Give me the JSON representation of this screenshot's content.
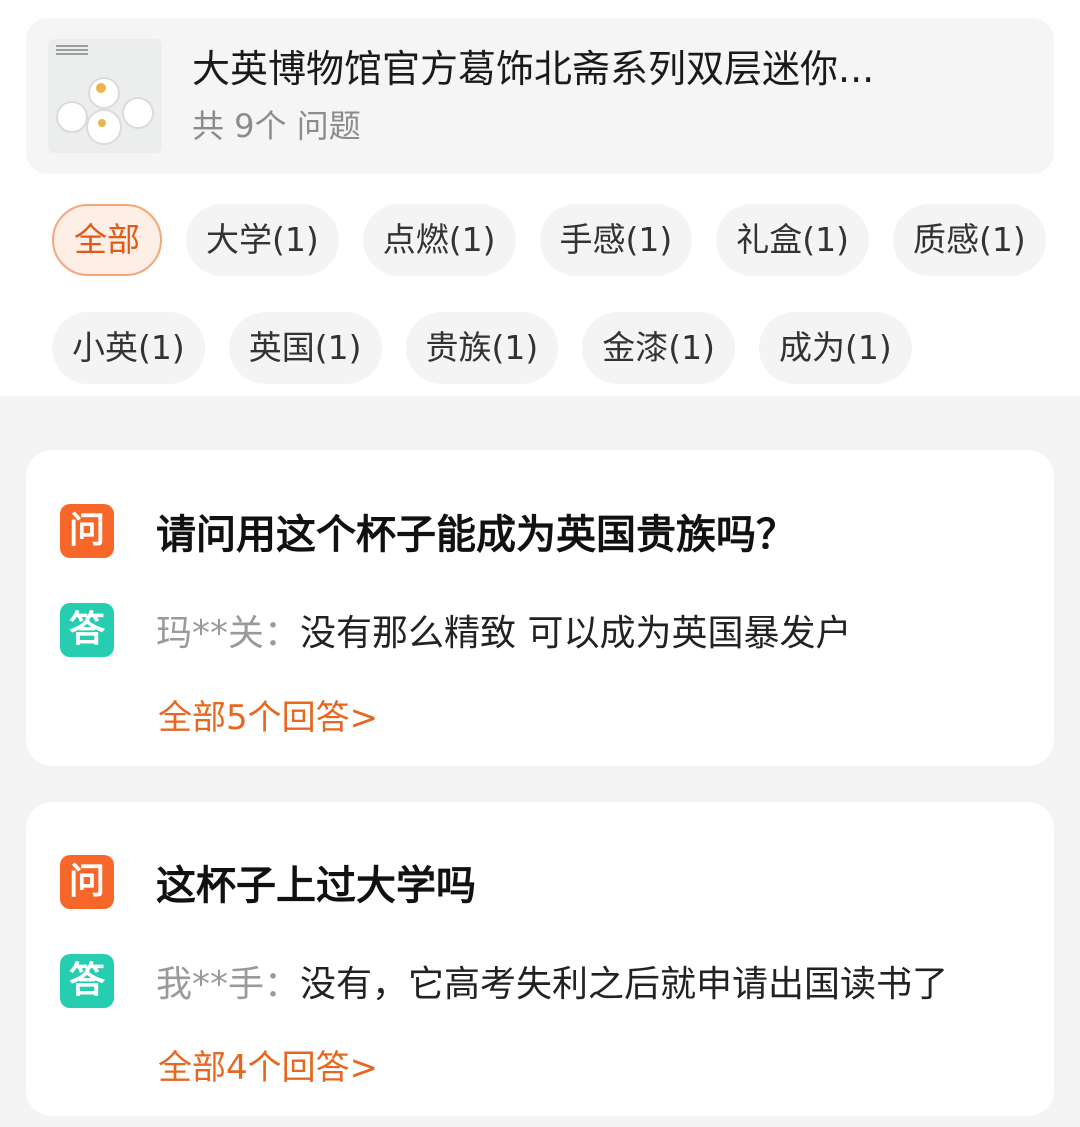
{
  "product": {
    "title": "大英博物馆官方葛饰北斋系列双层迷你...",
    "question_count": "共 9个 问题"
  },
  "tags": [
    "全部",
    "大学(1)",
    "点燃(1)",
    "手感(1)",
    "礼盒(1)",
    "质感(1)",
    "小英(1)",
    "英国(1)",
    "贵族(1)",
    "金漆(1)",
    "成为(1)"
  ],
  "qa": [
    {
      "q_badge": "问",
      "question": "请问用这个杯子能成为英国贵族吗？",
      "a_badge": "答",
      "user": "玛**关：",
      "answer": "没有那么精致 可以成为英国暴发户",
      "more": "全部5个回答>"
    },
    {
      "q_badge": "问",
      "question": "这杯子上过大学吗",
      "a_badge": "答",
      "user": "我**手：",
      "answer": "没有，它高考失利之后就申请出国读书了",
      "more": "全部4个回答>"
    }
  ]
}
